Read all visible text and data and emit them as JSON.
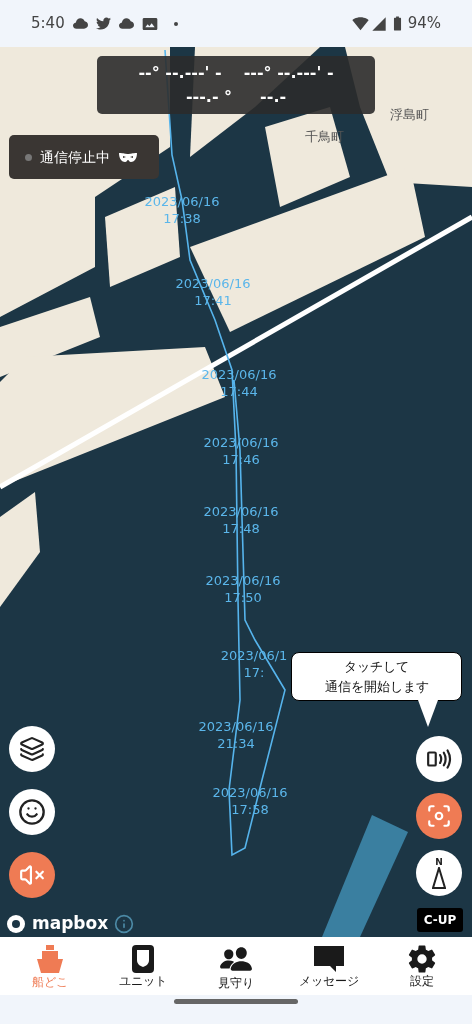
{
  "status_bar": {
    "time": "5:40",
    "battery": "94%"
  },
  "position_panel": {
    "latitude": "--° --.---' -",
    "longitude": "---° --.---' -",
    "course": "---.- °",
    "speed": "--.-"
  },
  "connection": {
    "label": "通信停止中",
    "connected": false
  },
  "place_names": [
    "千鳥町",
    "浮島町"
  ],
  "track_labels": [
    {
      "date": "2023/06/16",
      "time": "17:38"
    },
    {
      "date": "2023/06/16",
      "time": "17:41"
    },
    {
      "date": "2023/06/16",
      "time": "17:44"
    },
    {
      "date": "2023/06/16",
      "time": "17:46"
    },
    {
      "date": "2023/06/16",
      "time": "17:48"
    },
    {
      "date": "2023/06/16",
      "time": "17:50"
    },
    {
      "date": "2023/06/1",
      "time": "17:"
    },
    {
      "date": "2023/06/16",
      "time": "21:34"
    },
    {
      "date": "2023/06/16",
      "time": "17:58"
    }
  ],
  "callout": {
    "lines": [
      "タッチして",
      "通信を開始します"
    ]
  },
  "left_controls": [
    {
      "kind": "layers",
      "active": false
    },
    {
      "kind": "face",
      "active": false
    },
    {
      "kind": "mute",
      "active": true
    }
  ],
  "right_controls": [
    {
      "kind": "connect",
      "active": false
    },
    {
      "kind": "locate",
      "active": true
    },
    {
      "kind": "compass",
      "active": false,
      "letter": "N"
    }
  ],
  "orientation_badge": "C-UP",
  "attribution": "mapbox",
  "nav": [
    {
      "kind": "ship",
      "label": "船どこ",
      "selected": true
    },
    {
      "kind": "unit",
      "label": "ユニット",
      "selected": false
    },
    {
      "kind": "watch",
      "label": "見守り",
      "selected": false
    },
    {
      "kind": "message",
      "label": "メッセージ",
      "selected": false
    },
    {
      "kind": "settings",
      "label": "設定",
      "selected": false
    }
  ]
}
